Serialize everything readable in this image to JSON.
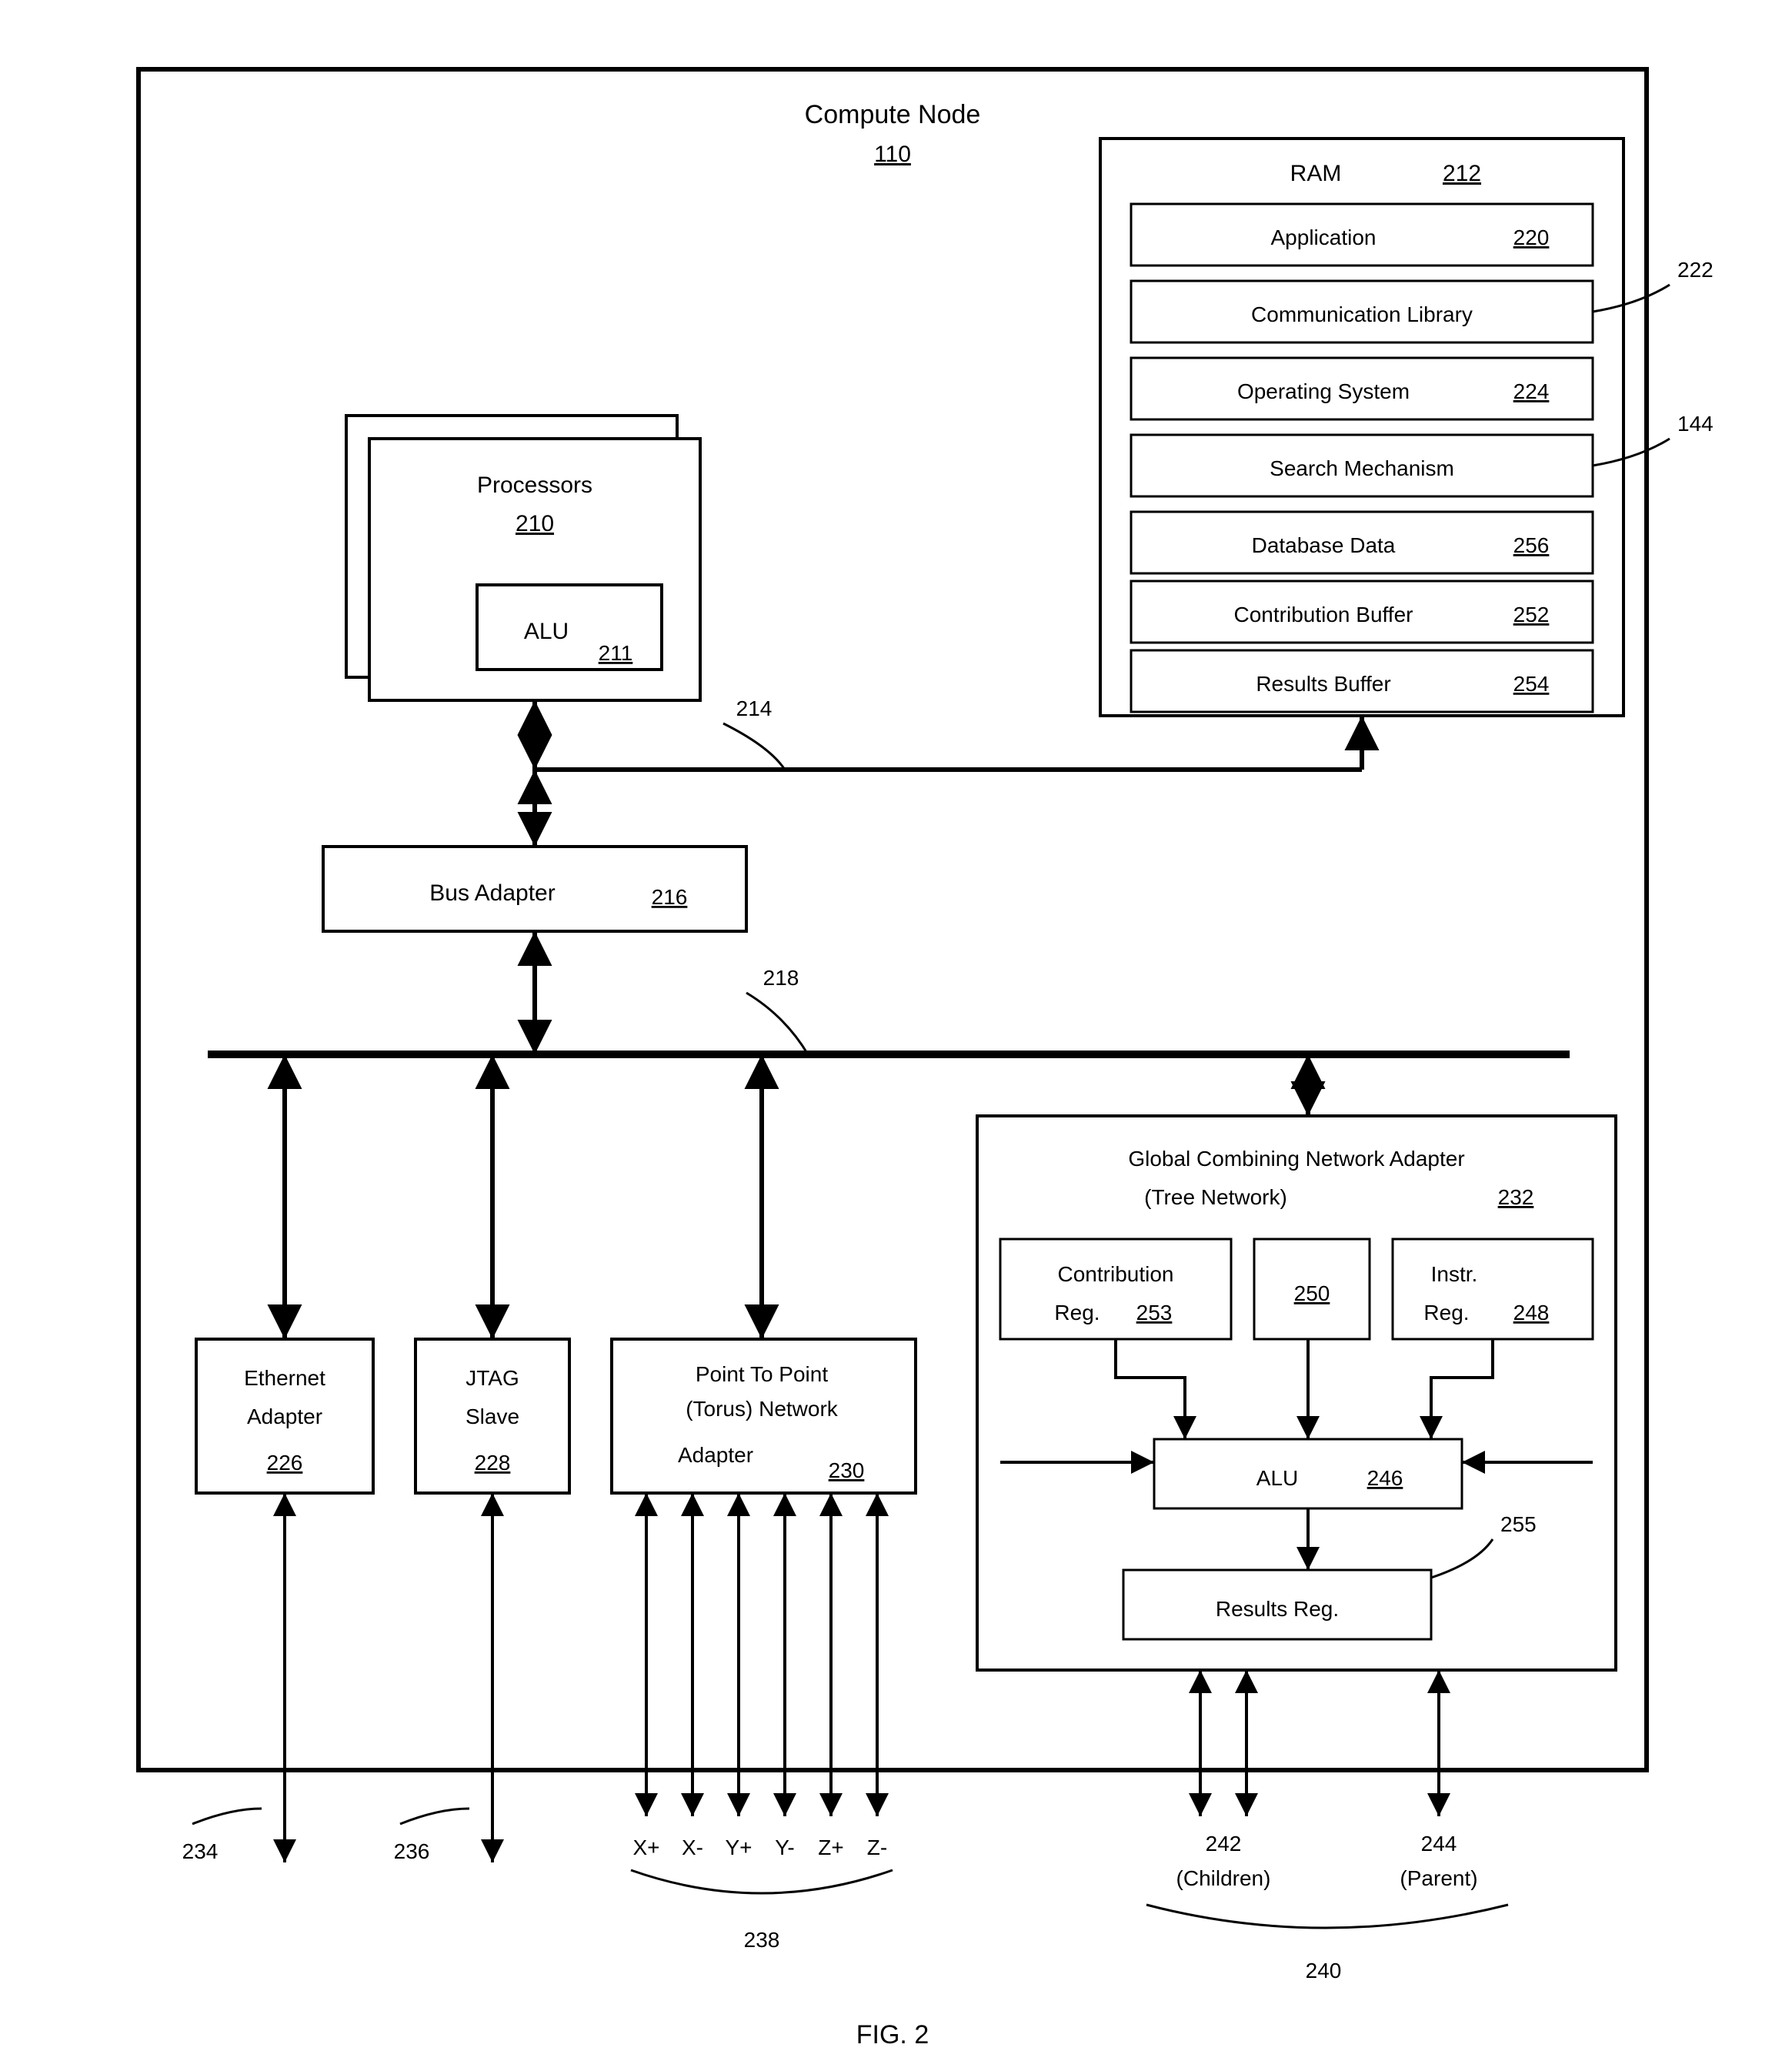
{
  "title": "Compute Node",
  "title_ref": "110",
  "processors": {
    "label": "Processors",
    "ref": "210",
    "alu_label": "ALU",
    "alu_ref": "211"
  },
  "ram": {
    "label": "RAM",
    "ref": "212",
    "application": {
      "label": "Application",
      "ref": "220"
    },
    "comm_lib": {
      "label": "Communication Library",
      "lead": "222"
    },
    "os": {
      "label": "Operating System",
      "ref": "224"
    },
    "search": {
      "label": "Search Mechanism",
      "lead": "144"
    },
    "db": {
      "label": "Database Data",
      "ref": "256"
    },
    "contrib": {
      "label": "Contribution Buffer",
      "ref": "252"
    },
    "results": {
      "label": "Results Buffer",
      "ref": "254"
    }
  },
  "front_bus_ref": "214",
  "bus_adapter": {
    "label": "Bus Adapter",
    "ref": "216"
  },
  "exp_bus_ref": "218",
  "eth": {
    "label1": "Ethernet",
    "label2": "Adapter",
    "ref": "226"
  },
  "jtag": {
    "label1": "JTAG",
    "label2": "Slave",
    "ref": "228"
  },
  "p2p": {
    "label1": "Point To Point",
    "label2": "(Torus) Network",
    "label3": "Adapter",
    "ref": "230"
  },
  "gcn": {
    "label1": "Global Combining Network Adapter",
    "label2": "(Tree Network)",
    "ref": "232",
    "contrib_reg": {
      "label1": "Contribution",
      "label2": "Reg.",
      "ref": "253"
    },
    "center_ref": "250",
    "instr_reg": {
      "label1": "Instr.",
      "label2": "Reg.",
      "ref": "248"
    },
    "alu": {
      "label": "ALU",
      "ref": "246"
    },
    "results_reg": {
      "label": "Results Reg.",
      "lead": "255"
    }
  },
  "io": {
    "eth_ref": "234",
    "jtag_ref": "236",
    "torus_labels": {
      "xp": "X+",
      "xm": "X-",
      "yp": "Y+",
      "ym": "Y-",
      "zp": "Z+",
      "zm": "Z-"
    },
    "torus_ref": "238",
    "children_ref": "242",
    "children_label": "(Children)",
    "parent_ref": "244",
    "parent_label": "(Parent)",
    "tree_ref": "240"
  },
  "figure": "FIG. 2"
}
